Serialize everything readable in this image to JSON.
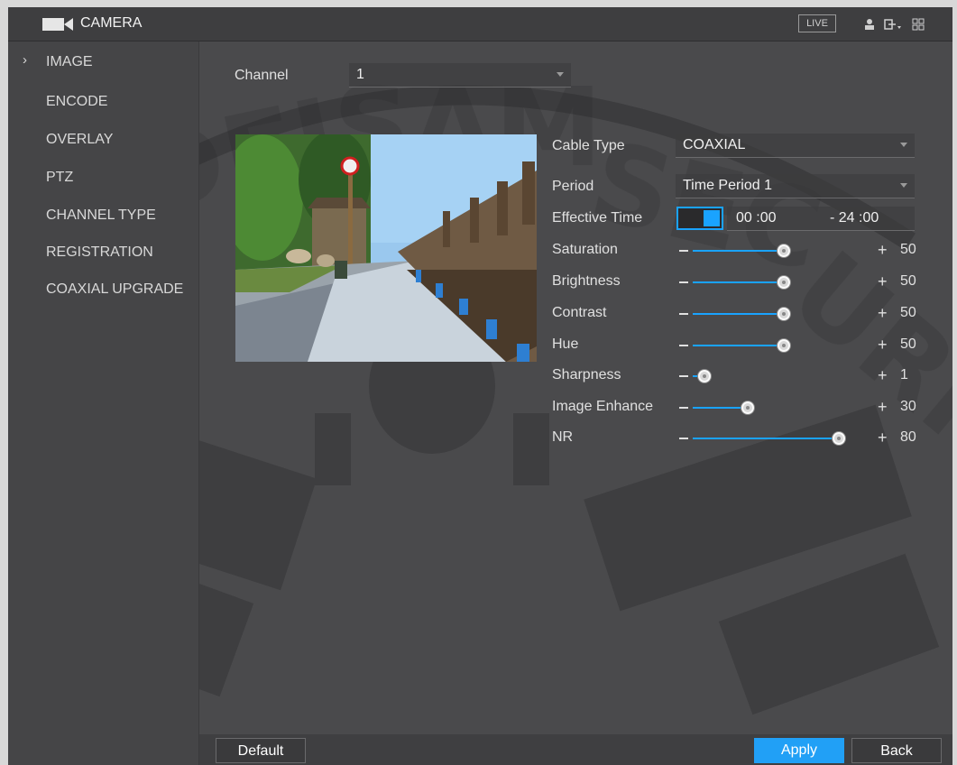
{
  "header": {
    "title": "CAMERA",
    "live_label": "LIVE",
    "icons": [
      "camera-icon",
      "user-icon",
      "logout-icon",
      "menu-grid-icon"
    ]
  },
  "sidebar": {
    "active_index": 0,
    "items": [
      {
        "label": "IMAGE"
      },
      {
        "label": "ENCODE"
      },
      {
        "label": "OVERLAY"
      },
      {
        "label": "PTZ"
      },
      {
        "label": "CHANNEL TYPE"
      },
      {
        "label": "REGISTRATION"
      },
      {
        "label": "COAXIAL UPGRADE"
      }
    ]
  },
  "channel": {
    "label": "Channel",
    "value": "1"
  },
  "settings": {
    "cable_type": {
      "label": "Cable Type",
      "value": "COAXIAL"
    },
    "period": {
      "label": "Period",
      "value": "Time Period 1"
    },
    "effective_time": {
      "label": "Effective Time",
      "start": "00 :00",
      "end": "- 24 :00",
      "enabled": true
    }
  },
  "sliders": [
    {
      "label": "Saturation",
      "value": 50,
      "min": 0,
      "max": 100
    },
    {
      "label": "Brightness",
      "value": 50,
      "min": 0,
      "max": 100
    },
    {
      "label": "Contrast",
      "value": 50,
      "min": 0,
      "max": 100
    },
    {
      "label": "Hue",
      "value": 50,
      "min": 0,
      "max": 100
    },
    {
      "label": "Sharpness",
      "value": 1,
      "min": 0,
      "max": 15
    },
    {
      "label": "Image Enhance",
      "value": 30,
      "min": 0,
      "max": 100
    },
    {
      "label": "NR",
      "value": 80,
      "min": 0,
      "max": 100
    }
  ],
  "buttons": {
    "default": "Default",
    "apply": "Apply",
    "back": "Back"
  },
  "watermark_text": "DELSAM SECURITY",
  "colors": {
    "accent": "#1aa3ff",
    "apply_bg": "#21a0f6",
    "panel": "#4a4a4c"
  }
}
